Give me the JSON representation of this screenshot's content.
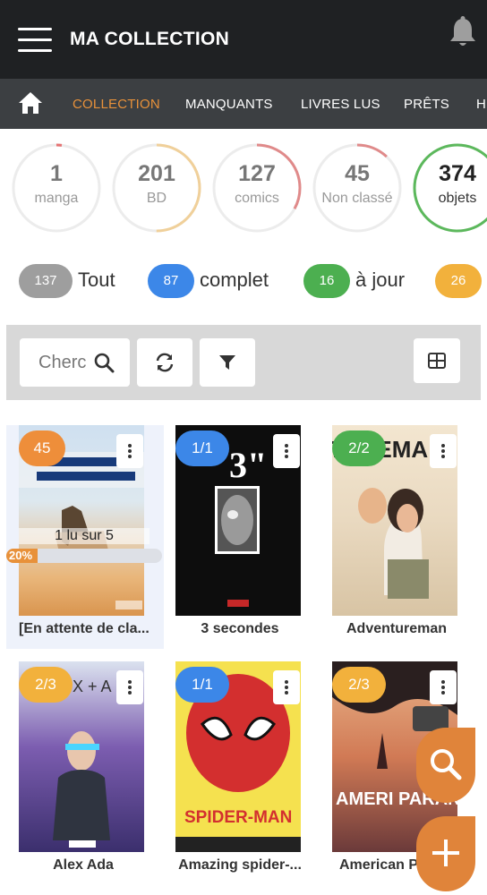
{
  "header": {
    "title": "MA COLLECTION"
  },
  "nav": {
    "tabs": [
      {
        "label": "COLLECTION",
        "active": true
      },
      {
        "label": "MANQUANTS"
      },
      {
        "label": "LIVRES LUS"
      },
      {
        "label": "PRÊTS"
      },
      {
        "label": "H"
      }
    ]
  },
  "stats": [
    {
      "value": "1",
      "label": "manga",
      "fraction": 0.02,
      "color": "#e57373"
    },
    {
      "value": "201",
      "label": "BD",
      "fraction": 0.5,
      "color": "#f0d09a"
    },
    {
      "value": "127",
      "label": "comics",
      "fraction": 0.33,
      "color": "#e08a8a"
    },
    {
      "value": "45",
      "label": "Non classé",
      "fraction": 0.12,
      "color": "#e08a8a"
    },
    {
      "value": "374",
      "label": "objets",
      "fraction": 1.0,
      "color": "#5cb85c"
    }
  ],
  "filters": [
    {
      "count": "137",
      "label": "Tout",
      "color": "#9e9e9e"
    },
    {
      "count": "87",
      "label": "complet",
      "color": "#3c87e8"
    },
    {
      "count": "16",
      "label": "à jour",
      "color": "#4caf50"
    },
    {
      "count": "26",
      "label": "",
      "color": "#f2b13c"
    }
  ],
  "toolbar": {
    "search_placeholder": "Cherc"
  },
  "colors": {
    "accent": "#e8913a",
    "fab": "#e0843a",
    "blue": "#3c87e8",
    "green": "#4caf50",
    "yellow": "#f2b13c",
    "orange": "#ee8e3a"
  },
  "books": [
    {
      "title": "[En attente de cla...",
      "badge": "45",
      "badge_color": "#ee8e3a",
      "read_text": "1 lu sur 5",
      "progress_label": "20%",
      "progress": 0.2
    },
    {
      "title": "3 secondes",
      "badge": "1/1",
      "badge_color": "#3c87e8",
      "cover_text": "3\""
    },
    {
      "title": "Adventureman",
      "badge": "2/2",
      "badge_color": "#4caf50",
      "cover_text": "TUREMA"
    },
    {
      "title": "Alex Ada",
      "badge": "2/3",
      "badge_color": "#f2b13c",
      "cover_text": "X + A D"
    },
    {
      "title": "Amazing spider-...",
      "badge": "1/1",
      "badge_color": "#3c87e8",
      "cover_text": "SPIDER-MAN"
    },
    {
      "title": "American Pa",
      "badge": "2/3",
      "badge_color": "#f2b13c",
      "cover_text": "AMERI PARANO"
    }
  ],
  "icons": [
    "menu-icon",
    "bell-icon",
    "home-icon",
    "search-icon",
    "refresh-icon",
    "filter-icon",
    "grid-icon",
    "kebab-icon",
    "search-fab-icon",
    "plus-icon"
  ]
}
